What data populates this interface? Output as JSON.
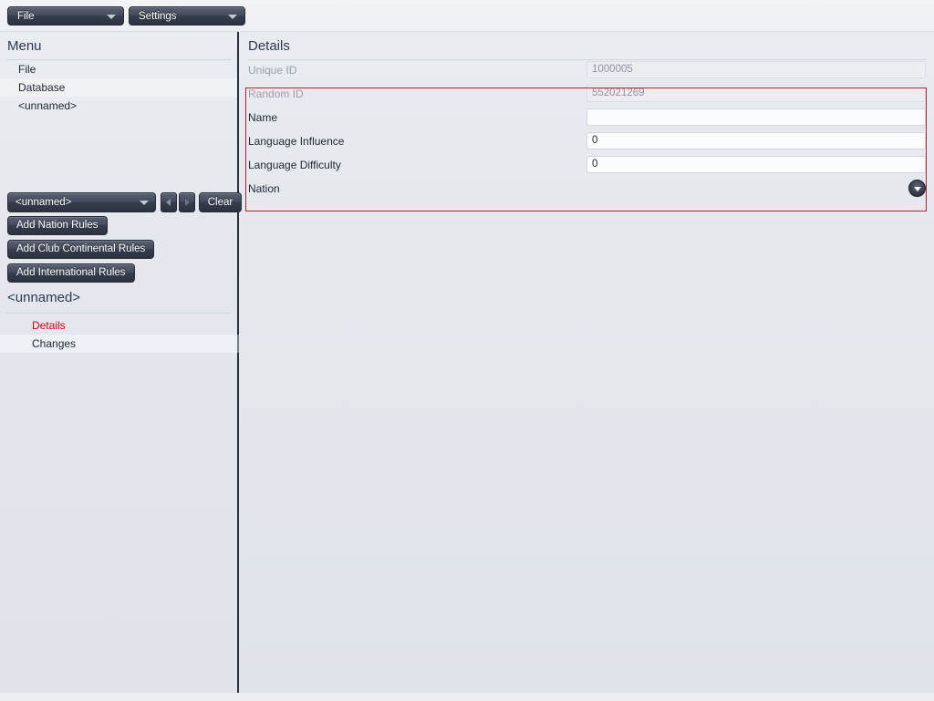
{
  "menubar": {
    "buttons": [
      {
        "label": "File",
        "icon": "chevron-down-icon"
      },
      {
        "label": "Settings",
        "icon": "chevron-down-icon"
      }
    ]
  },
  "sidebar": {
    "title": "Menu",
    "nav_items": [
      {
        "label": "File"
      },
      {
        "label": "Database"
      },
      {
        "label": "<unnamed>"
      }
    ],
    "combo": {
      "value": "<unnamed>",
      "icon": "chevron-down-icon",
      "prev_icon": "triangle-left-icon",
      "next_icon": "triangle-right-icon",
      "clear_label": "Clear"
    },
    "actions": [
      {
        "label": "Add Nation Rules"
      },
      {
        "label": "Add Club Continental Rules"
      },
      {
        "label": "Add International Rules"
      }
    ],
    "sub_title": "<unnamed>",
    "sub_items": [
      {
        "label": "Details",
        "selected": true
      },
      {
        "label": "Changes",
        "selected": false
      }
    ]
  },
  "details": {
    "title": "Details",
    "fields": [
      {
        "label": "Unique ID",
        "value": "1000005",
        "type": "text",
        "disabled": true
      },
      {
        "label": "Random ID",
        "value": "552021269",
        "type": "text",
        "disabled": true
      },
      {
        "label": "Name",
        "value": "",
        "type": "text",
        "disabled": false
      },
      {
        "label": "Language Influence",
        "value": "0",
        "type": "text",
        "disabled": false
      },
      {
        "label": "Language Difficulty",
        "value": "0",
        "type": "text",
        "disabled": false
      },
      {
        "label": "Nation",
        "value": "",
        "type": "picker",
        "disabled": false,
        "icon": "dropdown-circle-icon"
      }
    ]
  },
  "colors": {
    "selected_text": "#e8000d",
    "highlight_border": "#b9202b",
    "heading": "#2c3a52",
    "button_dark": "#2b323f"
  }
}
